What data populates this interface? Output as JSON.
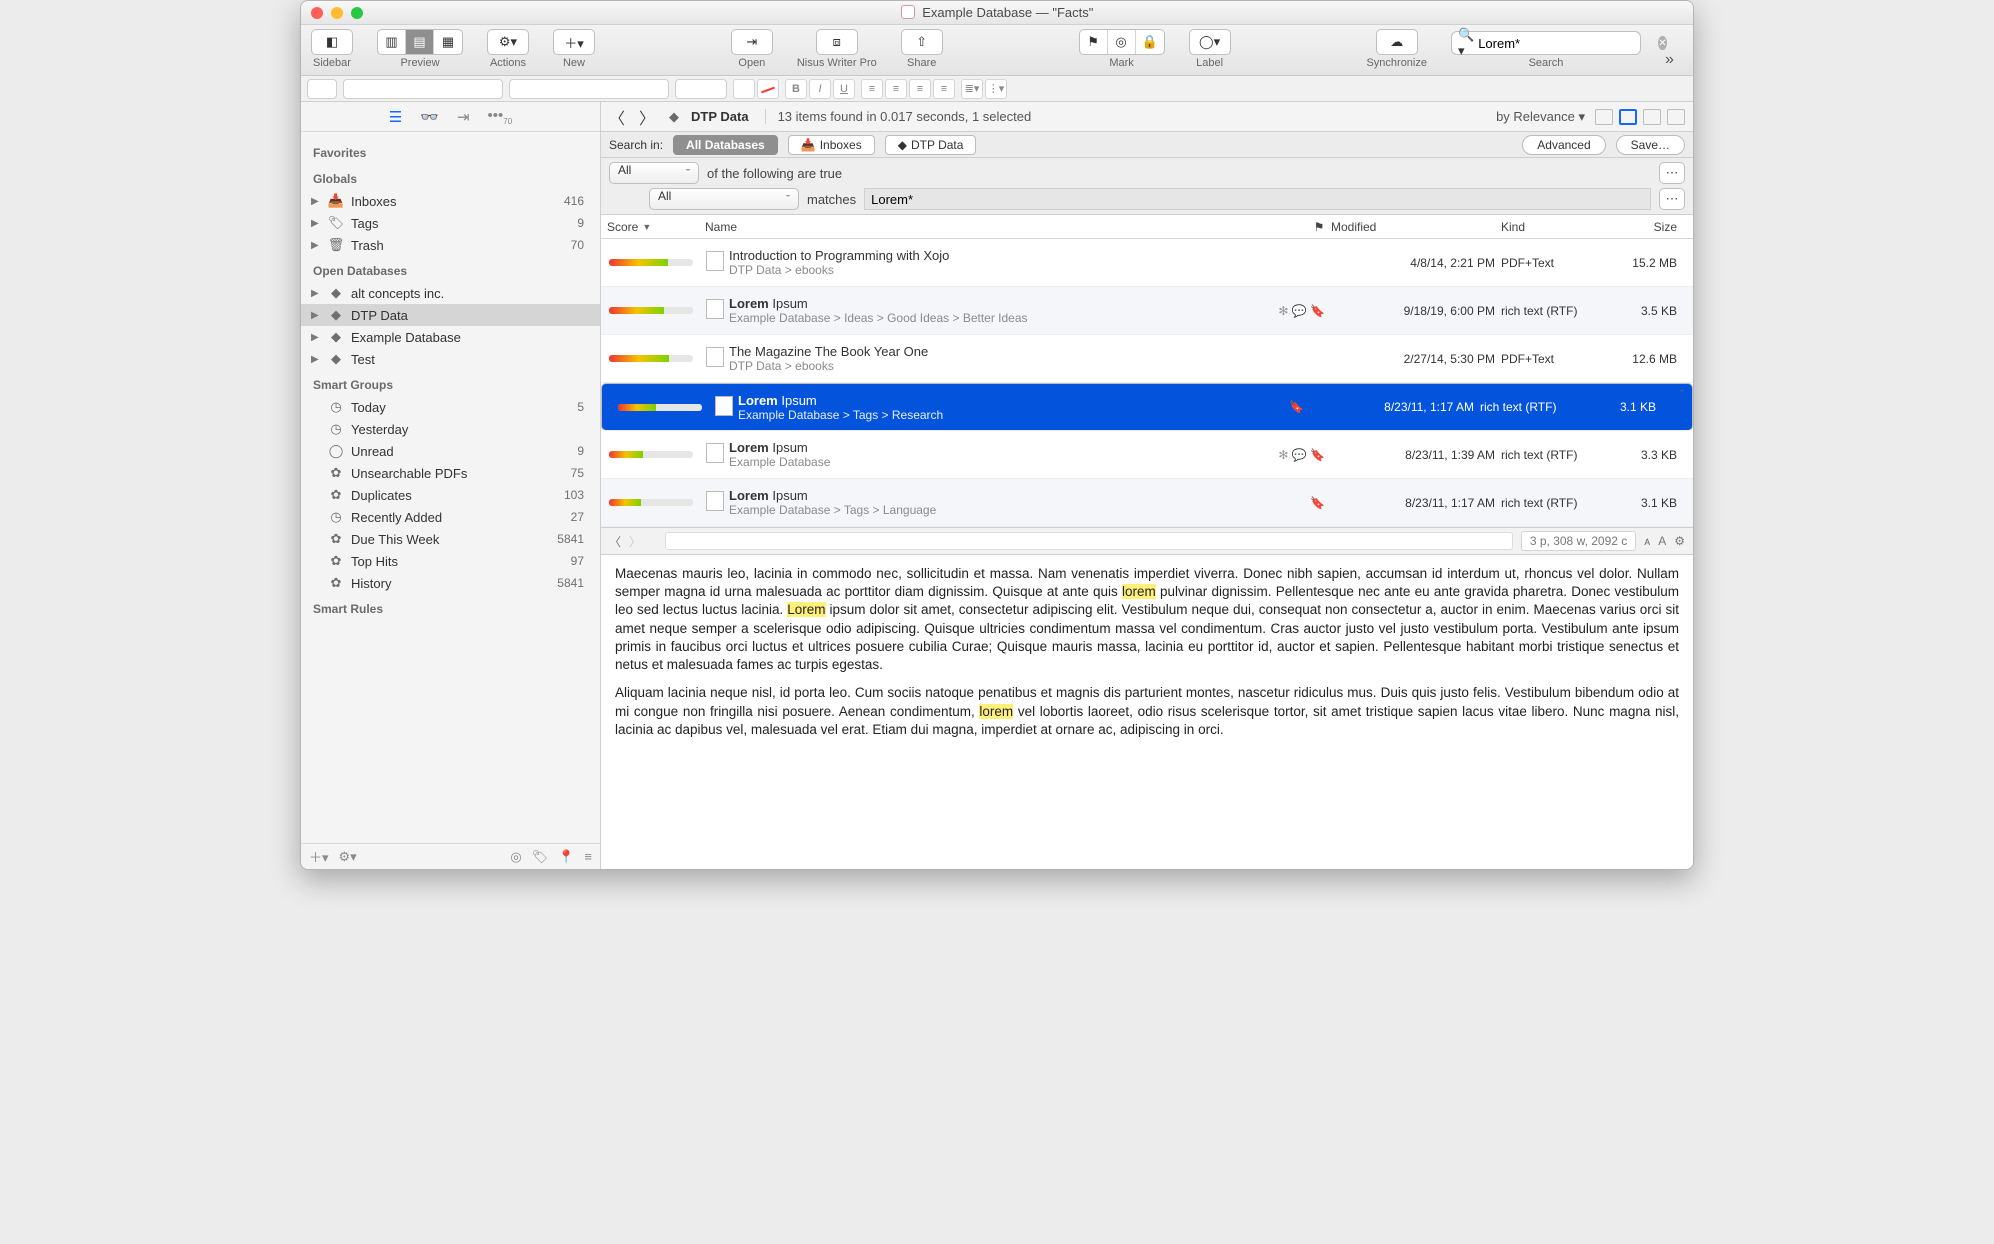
{
  "window": {
    "title": "Example Database — \"Facts\""
  },
  "toolbar": {
    "sidebar": "Sidebar",
    "preview": "Preview",
    "actions": "Actions",
    "new": "New",
    "open": "Open",
    "nisus": "Nisus Writer Pro",
    "share": "Share",
    "mark": "Mark",
    "label": "Label",
    "synchronize": "Synchronize",
    "search": "Search",
    "search_value": "Lorem*"
  },
  "sidebar": {
    "sections": {
      "favorites": "Favorites",
      "globals": "Globals",
      "open_db": "Open Databases",
      "smart_groups": "Smart Groups",
      "smart_rules": "Smart Rules"
    },
    "globals": [
      {
        "label": "Inboxes",
        "count": "416"
      },
      {
        "label": "Tags",
        "count": "9"
      },
      {
        "label": "Trash",
        "count": "70"
      }
    ],
    "open_db": [
      {
        "label": "alt concepts inc.",
        "selected": false
      },
      {
        "label": "DTP Data",
        "selected": true
      },
      {
        "label": "Example Database",
        "selected": false
      },
      {
        "label": "Test",
        "selected": false
      }
    ],
    "smart_groups": [
      {
        "label": "Today",
        "count": "5"
      },
      {
        "label": "Yesterday",
        "count": ""
      },
      {
        "label": "Unread",
        "count": "9"
      },
      {
        "label": "Unsearchable PDFs",
        "count": "75"
      },
      {
        "label": "Duplicates",
        "count": "103"
      },
      {
        "label": "Recently Added",
        "count": "27"
      },
      {
        "label": "Due This Week",
        "count": "5841"
      },
      {
        "label": "Top Hits",
        "count": "97"
      },
      {
        "label": "History",
        "count": "5841"
      }
    ]
  },
  "pathbar": {
    "location": "DTP Data",
    "status": "13 items found in 0.017 seconds, 1 selected",
    "sort": "by Relevance"
  },
  "searchin": {
    "label": "Search in:",
    "all_db": "All Databases",
    "inboxes": "Inboxes",
    "dtp": "DTP Data",
    "advanced": "Advanced",
    "save": "Save…"
  },
  "criteria": {
    "scope": "All",
    "scope_suffix": "of the following are true",
    "field": "All",
    "op": "matches",
    "value": "Lorem*"
  },
  "columns": {
    "score": "Score",
    "name": "Name",
    "modified": "Modified",
    "kind": "Kind",
    "size": "Size"
  },
  "results": [
    {
      "score": 70,
      "title_bold": "",
      "title_rest": "Introduction to Programming with Xojo",
      "path": "DTP Data > ebooks",
      "marks": [],
      "modified": "4/8/14, 2:21 PM",
      "kind": "PDF+Text",
      "size": "15.2 MB",
      "alt": false,
      "sel": false
    },
    {
      "score": 66,
      "title_bold": "Lorem",
      "title_rest": " Ipsum",
      "path": "Example Database > Ideas > Good Ideas > Better Ideas",
      "marks": [
        "✻",
        "💬",
        "🔖"
      ],
      "modified": "9/18/19, 6:00 PM",
      "kind": "rich text (RTF)",
      "size": "3.5 KB",
      "alt": true,
      "sel": false
    },
    {
      "score": 72,
      "title_bold": "",
      "title_rest": "The Magazine The Book Year One",
      "path": "DTP Data > ebooks",
      "marks": [],
      "modified": "2/27/14, 5:30 PM",
      "kind": "PDF+Text",
      "size": "12.6 MB",
      "alt": false,
      "sel": false
    },
    {
      "score": 45,
      "title_bold": "Lorem",
      "title_rest": " Ipsum",
      "path": "Example Database > Tags > Research",
      "marks": [
        "🔖"
      ],
      "modified": "8/23/11, 1:17 AM",
      "kind": "rich text (RTF)",
      "size": "3.1 KB",
      "alt": true,
      "sel": true
    },
    {
      "score": 40,
      "title_bold": "Lorem",
      "title_rest": " Ipsum",
      "path": "Example Database",
      "marks": [
        "✻",
        "💬",
        "🔖"
      ],
      "modified": "8/23/11, 1:39 AM",
      "kind": "rich text (RTF)",
      "size": "3.3 KB",
      "alt": false,
      "sel": false
    },
    {
      "score": 38,
      "title_bold": "Lorem",
      "title_rest": " Ipsum",
      "path": "Example Database > Tags > Language",
      "marks": [
        "🔖"
      ],
      "modified": "8/23/11, 1:17 AM",
      "kind": "rich text (RTF)",
      "size": "3.1 KB",
      "alt": true,
      "sel": false
    }
  ],
  "prevbar": {
    "stats": "3 p, 308 w, 2092 c"
  },
  "preview": {
    "p1a": "Maecenas mauris leo, lacinia in commodo nec, sollicitudin et massa. Nam venenatis imperdiet viverra. Donec nibh sapien, accumsan id interdum ut, rhoncus vel dolor. Nullam semper magna id urna malesuada ac porttitor diam dignissim. Quisque at ante quis ",
    "hl1": "lorem",
    "p1b": " pulvinar dignissim. Pellentesque nec ante eu ante gravida pharetra. Donec vestibulum leo sed lectus luctus lacinia. ",
    "hl2": "Lorem",
    "p1c": " ipsum dolor sit amet, consectetur adipiscing elit. Vestibulum neque dui, consequat non consectetur a, auctor in enim. Maecenas varius orci sit amet neque semper a scelerisque odio adipiscing. Quisque ultricies condimentum massa vel condimentum. Cras auctor justo vel justo vestibulum porta. Vestibulum ante ipsum primis in faucibus orci luctus et ultrices posuere cubilia Curae; Quisque mauris massa, lacinia eu porttitor id, auctor et sapien. Pellentesque habitant morbi tristique senectus et netus et malesuada fames ac turpis egestas.",
    "p2a": "Aliquam lacinia neque nisl, id porta leo. Cum sociis natoque penatibus et magnis dis parturient montes, nascetur ridiculus mus. Duis quis justo felis. Vestibulum bibendum odio at mi congue non fringilla nisi posuere. Aenean condimentum, ",
    "hl3": "lorem",
    "p2b": " vel lobortis laoreet, odio risus scelerisque tortor, sit amet tristique sapien lacus vitae libero. Nunc magna nisl, lacinia ac dapibus vel, malesuada vel erat. Etiam dui magna, imperdiet at ornare ac, adipiscing in orci."
  }
}
